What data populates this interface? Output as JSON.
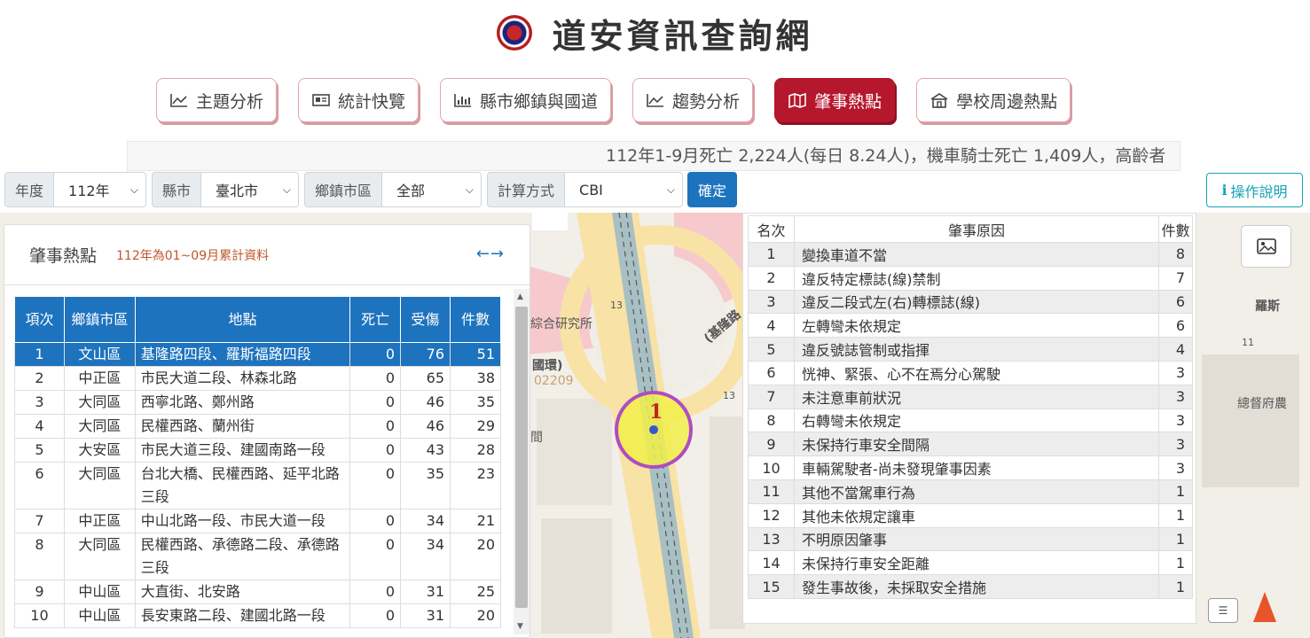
{
  "header": {
    "title": "道安資訊查詢網"
  },
  "nav": [
    {
      "label": "主題分析",
      "icon": "area-chart-icon"
    },
    {
      "label": "統計快覽",
      "icon": "newspaper-icon"
    },
    {
      "label": "縣市鄉鎮與國道",
      "icon": "bar-chart-icon"
    },
    {
      "label": "趨勢分析",
      "icon": "area-chart-icon"
    },
    {
      "label": "肇事熱點",
      "icon": "map-icon",
      "active": true
    },
    {
      "label": "學校周邊熱點",
      "icon": "school-icon"
    }
  ],
  "ticker": "112年1-9月死亡 2,224人(每日 8.24人)，機車騎士死亡 1,409人，高齡者",
  "filters": {
    "year": {
      "label": "年度",
      "value": "112年"
    },
    "county": {
      "label": "縣市",
      "value": "臺北市"
    },
    "town": {
      "label": "鄉鎮市區",
      "value": "全部"
    },
    "method": {
      "label": "計算方式",
      "value": "CBI"
    },
    "confirm": "確定",
    "help": "操作說明"
  },
  "map": {
    "labels": [
      "綜合研究所",
      "(基隆路",
      "國環)",
      "02209",
      "羅斯",
      "總督府農",
      "13",
      "13",
      "13",
      "11",
      "間"
    ],
    "marker_number": "1"
  },
  "hotspots": {
    "title": "肇事熱點",
    "subtitle": "112年為01~09月累計資料",
    "columns": [
      "項次",
      "鄉鎮市區",
      "地點",
      "死亡",
      "受傷",
      "件數"
    ],
    "rows": [
      {
        "no": "1",
        "district": "文山區",
        "location": "基隆路四段、羅斯福路四段",
        "deaths": "0",
        "injuries": "76",
        "count": "51"
      },
      {
        "no": "2",
        "district": "中正區",
        "location": "市民大道二段、林森北路",
        "deaths": "0",
        "injuries": "65",
        "count": "38"
      },
      {
        "no": "3",
        "district": "大同區",
        "location": "西寧北路、鄭州路",
        "deaths": "0",
        "injuries": "46",
        "count": "35"
      },
      {
        "no": "4",
        "district": "大同區",
        "location": "民權西路、蘭州街",
        "deaths": "0",
        "injuries": "46",
        "count": "29"
      },
      {
        "no": "5",
        "district": "大安區",
        "location": "市民大道三段、建國南路一段",
        "deaths": "0",
        "injuries": "43",
        "count": "28"
      },
      {
        "no": "6",
        "district": "大同區",
        "location": "台北大橋、民權西路、延平北路三段",
        "deaths": "0",
        "injuries": "35",
        "count": "23"
      },
      {
        "no": "7",
        "district": "中正區",
        "location": "中山北路一段、市民大道一段",
        "deaths": "0",
        "injuries": "34",
        "count": "21"
      },
      {
        "no": "8",
        "district": "大同區",
        "location": "民權西路、承德路二段、承德路三段",
        "deaths": "0",
        "injuries": "34",
        "count": "20"
      },
      {
        "no": "9",
        "district": "中山區",
        "location": "大直街、北安路",
        "deaths": "0",
        "injuries": "31",
        "count": "25"
      },
      {
        "no": "10",
        "district": "中山區",
        "location": "長安東路二段、建國北路一段",
        "deaths": "0",
        "injuries": "31",
        "count": "20"
      }
    ]
  },
  "causes": {
    "columns": [
      "名次",
      "肇事原因",
      "件數"
    ],
    "rows": [
      {
        "rank": "1",
        "cause": "變換車道不當",
        "count": "8"
      },
      {
        "rank": "2",
        "cause": "違反特定標誌(線)禁制",
        "count": "7"
      },
      {
        "rank": "3",
        "cause": "違反二段式左(右)轉標誌(線)",
        "count": "6"
      },
      {
        "rank": "4",
        "cause": "左轉彎未依規定",
        "count": "6"
      },
      {
        "rank": "5",
        "cause": "違反號誌管制或指揮",
        "count": "4"
      },
      {
        "rank": "6",
        "cause": "恍神、緊張、心不在焉分心駕駛",
        "count": "3"
      },
      {
        "rank": "7",
        "cause": "未注意車前狀況",
        "count": "3"
      },
      {
        "rank": "8",
        "cause": "右轉彎未依規定",
        "count": "3"
      },
      {
        "rank": "9",
        "cause": "未保持行車安全間隔",
        "count": "3"
      },
      {
        "rank": "10",
        "cause": "車輛駕駛者-尚未發現肇事因素",
        "count": "3"
      },
      {
        "rank": "11",
        "cause": "其他不當駕車行為",
        "count": "1"
      },
      {
        "rank": "12",
        "cause": "其他未依規定讓車",
        "count": "1"
      },
      {
        "rank": "13",
        "cause": "不明原因肇事",
        "count": "1"
      },
      {
        "rank": "14",
        "cause": "未保持行車安全距離",
        "count": "1"
      },
      {
        "rank": "15",
        "cause": "發生事故後，未採取安全措施",
        "count": "1"
      }
    ]
  }
}
